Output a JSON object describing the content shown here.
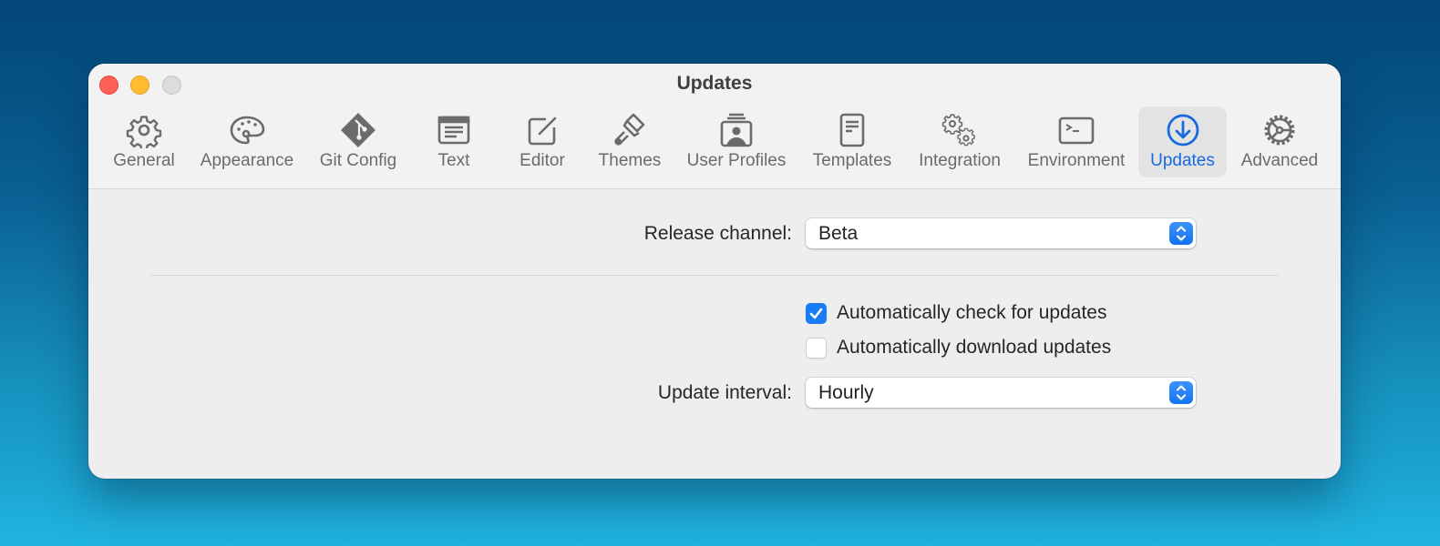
{
  "window": {
    "title": "Updates",
    "controls": [
      "close",
      "minimize",
      "zoom"
    ]
  },
  "toolbar": {
    "items": [
      {
        "label": "General",
        "icon": "gear-icon",
        "active": false
      },
      {
        "label": "Appearance",
        "icon": "palette-icon",
        "active": false
      },
      {
        "label": "Git Config",
        "icon": "git-icon",
        "active": false
      },
      {
        "label": "Text",
        "icon": "text-document-icon",
        "active": false
      },
      {
        "label": "Editor",
        "icon": "edit-pencil-icon",
        "active": false
      },
      {
        "label": "Themes",
        "icon": "paintbrush-icon",
        "active": false
      },
      {
        "label": "User Profiles",
        "icon": "user-profiles-icon",
        "active": false
      },
      {
        "label": "Templates",
        "icon": "template-document-icon",
        "active": false
      },
      {
        "label": "Integration",
        "icon": "gears-icon",
        "active": false
      },
      {
        "label": "Environment",
        "icon": "terminal-icon",
        "active": false
      },
      {
        "label": "Updates",
        "icon": "download-circle-icon",
        "active": true
      },
      {
        "label": "Advanced",
        "icon": "advanced-gear-icon",
        "active": false
      }
    ]
  },
  "colors": {
    "accent": "#1769e0",
    "checkbox_accent": "#1a7cf5"
  },
  "settings": {
    "release_channel": {
      "label": "Release channel:",
      "value": "Beta"
    },
    "auto_check": {
      "label": "Automatically check for updates",
      "checked": true
    },
    "auto_download": {
      "label": "Automatically download updates",
      "checked": false
    },
    "update_interval": {
      "label": "Update interval:",
      "value": "Hourly"
    }
  }
}
